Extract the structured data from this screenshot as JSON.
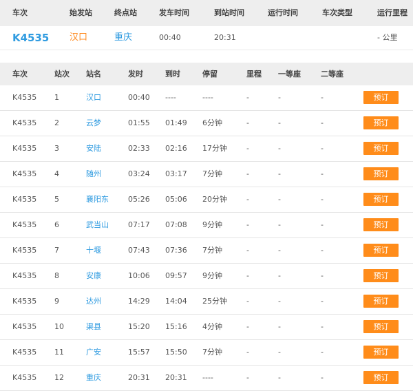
{
  "summary": {
    "headers": [
      "车次",
      "始发站",
      "终点站",
      "发车时间",
      "到站时间",
      "运行时间",
      "车次类型",
      "运行里程"
    ],
    "train": "K4535",
    "from": "汉口",
    "to": "重庆",
    "depart": "00:40",
    "arrive": "20:31",
    "duration": "",
    "type": "",
    "mileage": "- 公里"
  },
  "table": {
    "headers": [
      "车次",
      "站次",
      "站名",
      "发时",
      "到时",
      "停留",
      "里程",
      "一等座",
      "二等座"
    ],
    "book_label": "预订",
    "rows": [
      {
        "train": "K4535",
        "no": "1",
        "name": "汉口",
        "dep": "00:40",
        "arr": "----",
        "stay": "----",
        "mile": "-",
        "first": "-",
        "second": "-"
      },
      {
        "train": "K4535",
        "no": "2",
        "name": "云梦",
        "dep": "01:55",
        "arr": "01:49",
        "stay": "6分钟",
        "mile": "-",
        "first": "-",
        "second": "-"
      },
      {
        "train": "K4535",
        "no": "3",
        "name": "安陆",
        "dep": "02:33",
        "arr": "02:16",
        "stay": "17分钟",
        "mile": "-",
        "first": "-",
        "second": "-"
      },
      {
        "train": "K4535",
        "no": "4",
        "name": "随州",
        "dep": "03:24",
        "arr": "03:17",
        "stay": "7分钟",
        "mile": "-",
        "first": "-",
        "second": "-"
      },
      {
        "train": "K4535",
        "no": "5",
        "name": "襄阳东",
        "dep": "05:26",
        "arr": "05:06",
        "stay": "20分钟",
        "mile": "-",
        "first": "-",
        "second": "-"
      },
      {
        "train": "K4535",
        "no": "6",
        "name": "武当山",
        "dep": "07:17",
        "arr": "07:08",
        "stay": "9分钟",
        "mile": "-",
        "first": "-",
        "second": "-"
      },
      {
        "train": "K4535",
        "no": "7",
        "name": "十堰",
        "dep": "07:43",
        "arr": "07:36",
        "stay": "7分钟",
        "mile": "-",
        "first": "-",
        "second": "-"
      },
      {
        "train": "K4535",
        "no": "8",
        "name": "安康",
        "dep": "10:06",
        "arr": "09:57",
        "stay": "9分钟",
        "mile": "-",
        "first": "-",
        "second": "-"
      },
      {
        "train": "K4535",
        "no": "9",
        "name": "达州",
        "dep": "14:29",
        "arr": "14:04",
        "stay": "25分钟",
        "mile": "-",
        "first": "-",
        "second": "-"
      },
      {
        "train": "K4535",
        "no": "10",
        "name": "渠县",
        "dep": "15:20",
        "arr": "15:16",
        "stay": "4分钟",
        "mile": "-",
        "first": "-",
        "second": "-"
      },
      {
        "train": "K4535",
        "no": "11",
        "name": "广安",
        "dep": "15:57",
        "arr": "15:50",
        "stay": "7分钟",
        "mile": "-",
        "first": "-",
        "second": "-"
      },
      {
        "train": "K4535",
        "no": "12",
        "name": "重庆",
        "dep": "20:31",
        "arr": "20:31",
        "stay": "----",
        "mile": "-",
        "first": "-",
        "second": "-"
      }
    ]
  },
  "colors": {
    "accent_blue": "#2f9be0",
    "accent_orange": "#ff8c1a",
    "header_bg": "#eeeeee"
  }
}
